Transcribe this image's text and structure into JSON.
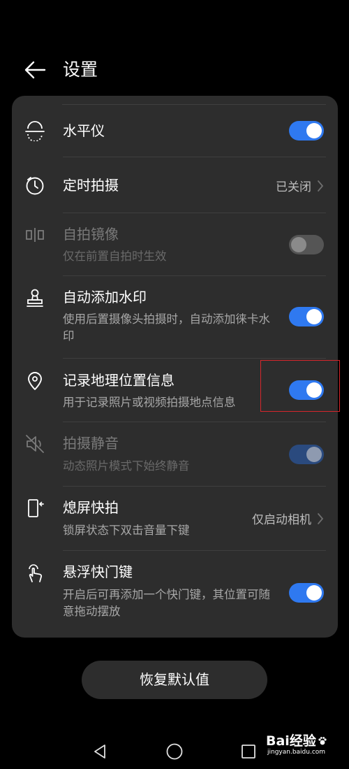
{
  "header": {
    "back_icon": "arrow-left-icon",
    "title": "设置"
  },
  "settings": {
    "level": {
      "title": "水平仪",
      "icon": "level-icon",
      "toggle": "on"
    },
    "timer": {
      "title": "定时拍摄",
      "value": "已关闭",
      "icon": "timer-icon"
    },
    "mirror": {
      "title": "自拍镜像",
      "subtitle": "仅在前置自拍时生效",
      "icon": "mirror-icon",
      "toggle": "off",
      "disabled": true
    },
    "watermark": {
      "title": "自动添加水印",
      "subtitle": "使用后置摄像头拍摄时，自动添加徕卡水印",
      "icon": "stamp-icon",
      "toggle": "on"
    },
    "location": {
      "title": "记录地理位置信息",
      "subtitle": "用于记录照片或视频拍摄地点信息",
      "icon": "location-pin-icon",
      "toggle": "on",
      "highlighted": true
    },
    "mute": {
      "title": "拍摄静音",
      "subtitle": "动态照片模式下始终静音",
      "icon": "mute-icon",
      "toggle": "on",
      "disabled": true
    },
    "snapshot": {
      "title": "熄屏快拍",
      "subtitle": "锁屏状态下双击音量下键",
      "value": "仅启动相机",
      "icon": "phone-side-key-icon"
    },
    "floating_shutter": {
      "title": "悬浮快门键",
      "subtitle": "开启后可再添加一个快门键，其位置可随意拖动摆放",
      "icon": "tap-hand-icon",
      "toggle": "on"
    }
  },
  "reset_button": {
    "label": "恢复默认值"
  },
  "navbar": {
    "back_icon": "triangle-back-icon",
    "home_icon": "circle-home-icon",
    "recents_icon": "square-recents-icon"
  },
  "watermark": {
    "main": "Bai经验",
    "sub": "jingyan.baidu.com",
    "icon": "baidu-paw-icon"
  },
  "colors": {
    "background": "#000000",
    "card": "#2d2d2d",
    "accent": "#2f79f0",
    "highlight_border": "#d6262b"
  }
}
